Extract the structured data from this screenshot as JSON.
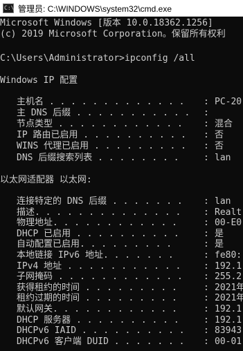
{
  "window": {
    "title": "管理员: C:\\WINDOWS\\system32\\cmd.exe",
    "icon": "cmd-icon",
    "icon_glyph": "C:\\"
  },
  "console": {
    "header_lines": [
      "Microsoft Windows [版本 10.0.18362.1256]",
      "(c) 2019 Microsoft Corporation。保留所有权利",
      "C:\\Users\\Administrator>ipconfig /all",
      "Windows IP 配置",
      "以太网适配器 以太网:"
    ],
    "ip_config": [
      {
        "label": "主机名 . . . . . . . . . . . . .",
        "sep": ":",
        "value": "PC-20"
      },
      {
        "label": "主 DNS 后缀 . . . . . . . . . . .",
        "sep": ":",
        "value": ""
      },
      {
        "label": "节点类型 . . . . . . . . . . . .",
        "sep": ":",
        "value": "混合"
      },
      {
        "label": "IP 路由已启用 . . . . . . . . . .",
        "sep": ":",
        "value": "否"
      },
      {
        "label": "WINS 代理已启用 . . . . . . . . .",
        "sep": ":",
        "value": "否"
      },
      {
        "label": "DNS 后缀搜索列表 . . . . . . . .",
        "sep": ":",
        "value": "lan"
      }
    ],
    "adapter": [
      {
        "label": "连接特定的 DNS 后缀 . . . . . . .",
        "sep": ":",
        "value": "lan"
      },
      {
        "label": "描述. . . . . . . . . . . . . .",
        "sep": ":",
        "value": "Realt"
      },
      {
        "label": "物理地址. . . . . . . . . . . .",
        "sep": ":",
        "value": "00-E0"
      },
      {
        "label": "DHCP 已启用 . . . . . . . . . .",
        "sep": ":",
        "value": "是"
      },
      {
        "label": "自动配置已启用. . . . . . . . .",
        "sep": ":",
        "value": "是"
      },
      {
        "label": "本地链接 IPv6 地址. . . . . . .",
        "sep": ":",
        "value": "fe80:"
      },
      {
        "label": "IPv4 地址 . . . . . . . . . . .",
        "sep": ":",
        "value": "192.1"
      },
      {
        "label": "子网掩码 . . . . . . . . . . . .",
        "sep": ":",
        "value": "255.2"
      },
      {
        "label": "获得租约的时间 . . . . . . . . .",
        "sep": ":",
        "value": "2021年"
      },
      {
        "label": "租约过期的时间 . . . . . . . . .",
        "sep": ":",
        "value": "2021年"
      },
      {
        "label": "默认网关. . . . . . . . . . . .",
        "sep": ":",
        "value": "192.1"
      },
      {
        "label": "DHCP 服务器 . . . . . . . . . .",
        "sep": ":",
        "value": "192.1"
      },
      {
        "label": "DHCPv6 IAID . . . . . . . . . .",
        "sep": ":",
        "value": "83943"
      },
      {
        "label": "DHCPv6 客户端 DUID . . . . . . .",
        "sep": ":",
        "value": "00-01"
      }
    ]
  },
  "colors": {
    "background": "#0c0c0c",
    "text": "#cccccc",
    "titlebar": "#ffffff"
  }
}
